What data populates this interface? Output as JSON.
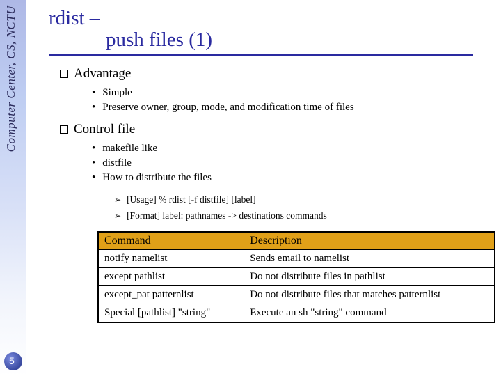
{
  "sidebar": {
    "text": "Computer Center, CS, NCTU",
    "page_number": "5"
  },
  "title": {
    "line1": "rdist –",
    "line2": "push files (1)"
  },
  "sections": [
    {
      "heading": "Advantage",
      "items": [
        "Simple",
        "Preserve owner, group, mode, and modification time of files"
      ]
    },
    {
      "heading": "Control file",
      "items": [
        "makefile like",
        "distfile",
        "How to distribute the files"
      ],
      "arrows": [
        "[Usage] % rdist [-f distfile] [label]",
        "[Format] label: pathnames -> destinations commands"
      ]
    }
  ],
  "table": {
    "headers": [
      "Command",
      "Description"
    ],
    "rows": [
      [
        "notify namelist",
        "Sends email to namelist"
      ],
      [
        "except pathlist",
        "Do not distribute files in pathlist"
      ],
      [
        "except_pat patternlist",
        "Do not distribute files that matches patternlist"
      ],
      [
        "Special [pathlist] \"string\"",
        "Execute an sh \"string\" command"
      ]
    ]
  }
}
